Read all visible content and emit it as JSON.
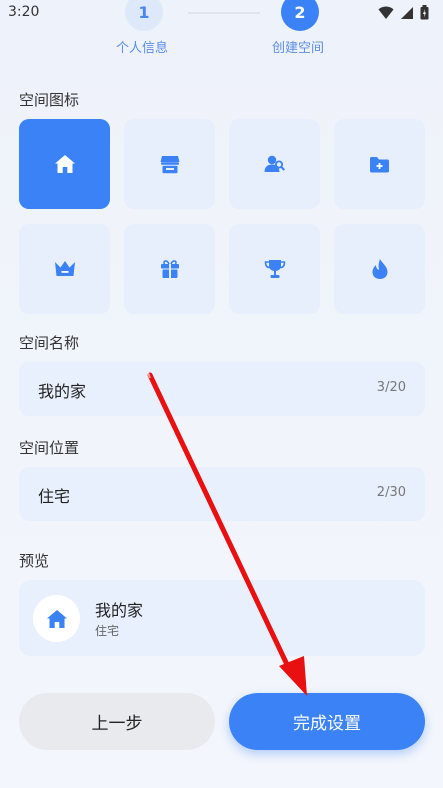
{
  "status_bar": {
    "time": "3:20"
  },
  "stepper": {
    "steps": [
      {
        "number": "1",
        "label": "个人信息"
      },
      {
        "number": "2",
        "label": "创建空间"
      }
    ]
  },
  "icon_section": {
    "title": "空间图标",
    "icons": [
      "home-icon",
      "store-icon",
      "people-icon",
      "folder-add-icon",
      "crown-icon",
      "gift-icon",
      "trophy-icon",
      "flame-icon"
    ],
    "selected": "home-icon"
  },
  "name_section": {
    "title": "空间名称",
    "value": "我的家",
    "count": "3/20"
  },
  "location_section": {
    "title": "空间位置",
    "value": "住宅",
    "count": "2/30"
  },
  "preview_section": {
    "title": "预览",
    "name": "我的家",
    "location": "住宅"
  },
  "buttons": {
    "prev_label": "上一步",
    "finish_label": "完成设置"
  },
  "colors": {
    "accent": "#3b82f6",
    "tile_bg": "#e7effc",
    "annotation_arrow": "#e81010"
  }
}
